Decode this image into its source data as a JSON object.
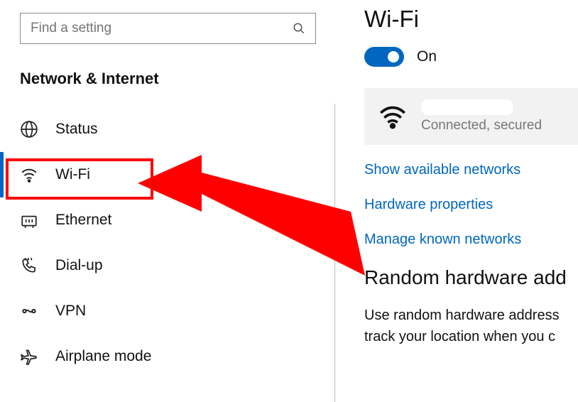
{
  "search": {
    "placeholder": "Find a setting"
  },
  "sectionTitle": "Network & Internet",
  "nav": {
    "status": {
      "label": "Status"
    },
    "wifi": {
      "label": "Wi-Fi"
    },
    "ethernet": {
      "label": "Ethernet"
    },
    "dialup": {
      "label": "Dial-up"
    },
    "vpn": {
      "label": "VPN"
    },
    "airplane": {
      "label": "Airplane mode"
    }
  },
  "main": {
    "title": "Wi-Fi",
    "toggleLabel": "On",
    "connection": {
      "status": "Connected, secured"
    },
    "links": {
      "showAvailable": "Show available networks",
      "hardwareProps": "Hardware properties",
      "manageKnown": "Manage known networks"
    },
    "randomSection": {
      "heading": "Random hardware add",
      "body1": "Use random hardware address",
      "body2": "track your location when you c"
    }
  }
}
